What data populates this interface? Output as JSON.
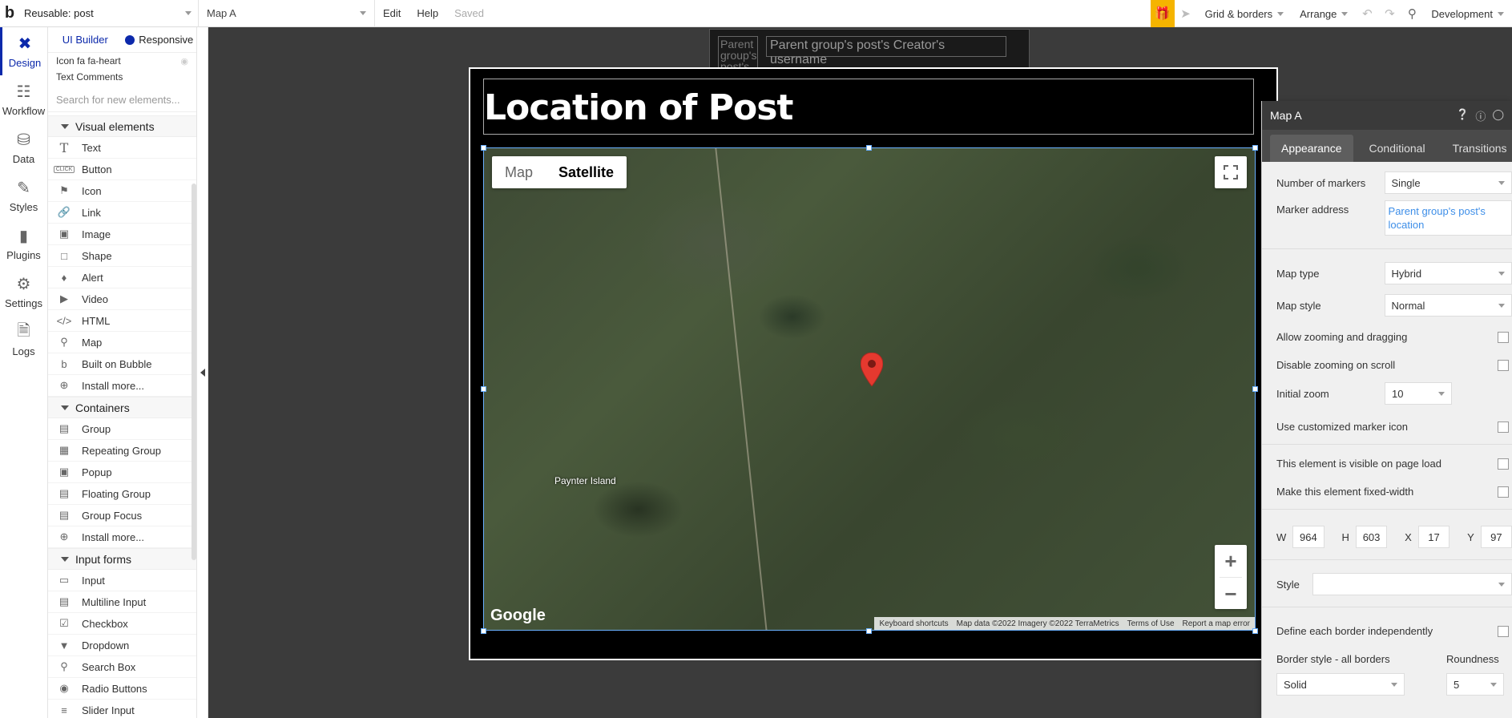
{
  "topbar": {
    "page_label": "Reusable: post",
    "element_label": "Map A",
    "menu": [
      "Edit",
      "Help"
    ],
    "saved": "Saved",
    "grid": "Grid & borders",
    "arrange": "Arrange",
    "env": "Development"
  },
  "leftnav": [
    {
      "label": "Design"
    },
    {
      "label": "Workflow"
    },
    {
      "label": "Data"
    },
    {
      "label": "Styles"
    },
    {
      "label": "Plugins"
    },
    {
      "label": "Settings"
    },
    {
      "label": "Logs"
    }
  ],
  "palette": {
    "tab_builder": "UI Builder",
    "tab_responsive": "Responsive",
    "layers": [
      "Icon fa fa-heart",
      "Text Comments"
    ],
    "search_placeholder": "Search for new elements...",
    "visual_header": "Visual elements",
    "visual": [
      "Text",
      "Button",
      "Icon",
      "Link",
      "Image",
      "Shape",
      "Alert",
      "Video",
      "HTML",
      "Map",
      "Built on Bubble",
      "Install more..."
    ],
    "containers_header": "Containers",
    "containers": [
      "Group",
      "Repeating Group",
      "Popup",
      "Floating Group",
      "Group Focus",
      "Install more..."
    ],
    "inputs_header": "Input forms",
    "inputs": [
      "Input",
      "Multiline Input",
      "Checkbox",
      "Dropdown",
      "Search Box",
      "Radio Buttons",
      "Slider Input"
    ]
  },
  "canvas": {
    "bg_avatar_text": "Parent group's post's",
    "bg_field_text": "Parent group's post's Creator's username",
    "title": "Location of Post",
    "map": {
      "btn_map": "Map",
      "btn_satellite": "Satellite",
      "place": "Paynter Island",
      "google": "Google",
      "attribution": [
        "Keyboard shortcuts",
        "Map data ©2022 Imagery ©2022 TerraMetrics",
        "Terms of Use",
        "Report a map error"
      ],
      "zoom_in": "+",
      "zoom_out": "−"
    }
  },
  "props": {
    "title": "Map A",
    "tabs": [
      "Appearance",
      "Conditional",
      "Transitions"
    ],
    "num_markers_label": "Number of markers",
    "num_markers": "Single",
    "marker_address_label": "Marker address",
    "marker_address": "Parent group's post's location",
    "map_type_label": "Map type",
    "map_type": "Hybrid",
    "map_style_label": "Map style",
    "map_style": "Normal",
    "allow_zoom": "Allow zooming and dragging",
    "disable_scroll": "Disable zooming on scroll",
    "initial_zoom_label": "Initial zoom",
    "initial_zoom": "10",
    "custom_marker": "Use customized marker icon",
    "visible": "This element is visible on page load",
    "fixed_width": "Make this element fixed-width",
    "w_label": "W",
    "w": "964",
    "h_label": "H",
    "h": "603",
    "x_label": "X",
    "x": "17",
    "y_label": "Y",
    "y": "97",
    "style_label": "Style",
    "border_indep": "Define each border independently",
    "border_style_label": "Border style - all borders",
    "roundness_label": "Roundness",
    "border_style": "Solid",
    "roundness": "5"
  }
}
